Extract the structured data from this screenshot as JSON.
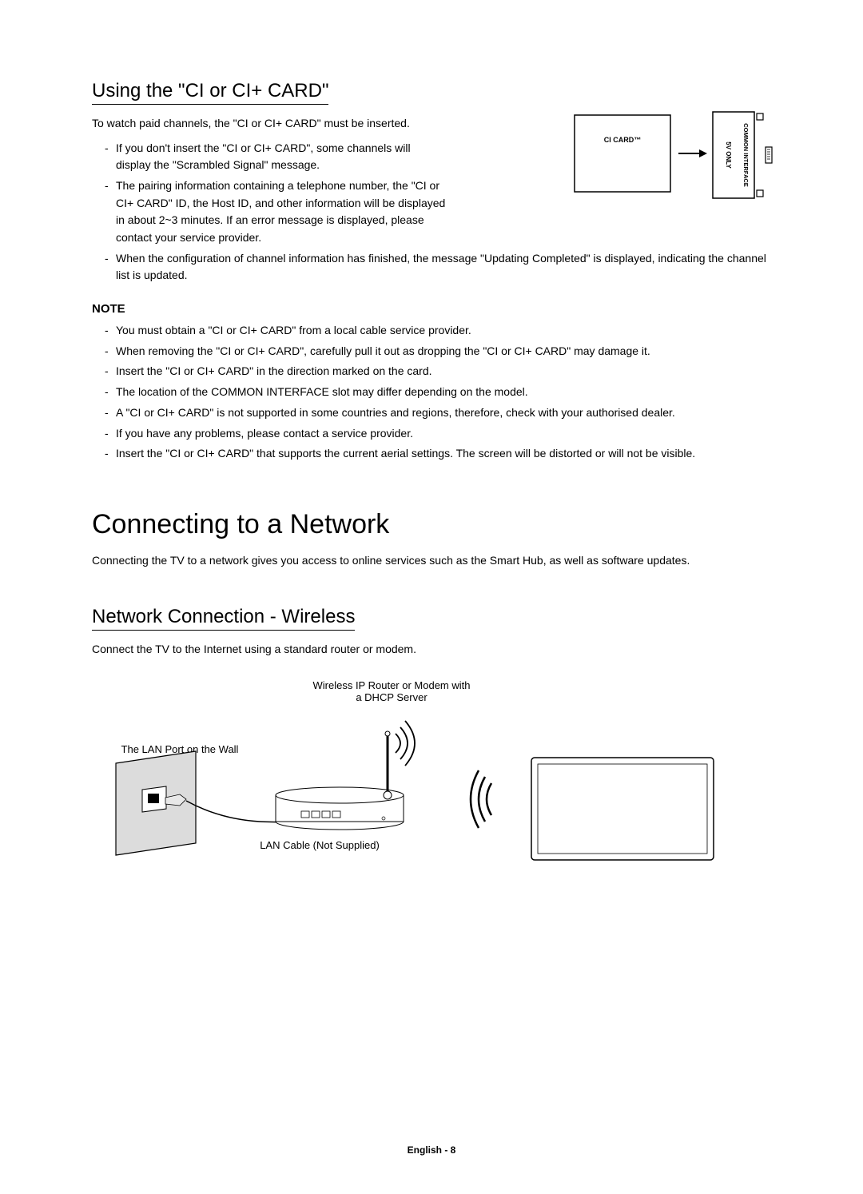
{
  "section1": {
    "title": "Using the \"CI or CI+ CARD\"",
    "intro": "To watch paid channels, the \"CI or CI+ CARD\" must be inserted.",
    "bullets": [
      "If you don't insert the \"CI or CI+ CARD\", some channels will display the \"Scrambled Signal\" message.",
      "The pairing information containing a telephone number, the \"CI or CI+ CARD\" ID, the Host ID, and other information will be displayed in about 2~3 minutes. If an error message is displayed, please contact your service provider.",
      "When the configuration of channel information has finished, the message \"Updating Completed\" is displayed, indicating the channel list is updated."
    ],
    "note_heading": "NOTE",
    "note_bullets": [
      "You must obtain a \"CI or CI+ CARD\" from a local cable service provider.",
      "When removing the \"CI or CI+ CARD\", carefully pull it out as dropping the \"CI or CI+ CARD\" may damage it.",
      "Insert the \"CI or CI+ CARD\" in the direction marked on the card.",
      "The location of the COMMON INTERFACE slot may differ depending on the model.",
      "A \"CI or CI+ CARD\" is not supported in some countries and regions, therefore, check with your authorised dealer.",
      "If you have any problems, please contact a service provider.",
      "Insert the \"CI or CI+ CARD\" that supports the current aerial settings. The screen will be distorted or will not be visible."
    ]
  },
  "section2": {
    "heading": "Connecting to a Network",
    "intro": "Connecting the TV to a network gives you access to online services such as the Smart Hub, as well as software updates.",
    "subsection_title": "Network Connection - Wireless",
    "sub_intro": "Connect the TV to the Internet using a standard router or modem."
  },
  "diagram_ci": {
    "card_label": "CI CARD™",
    "slot_label_top": "COMMON INTERFACE",
    "slot_label_bottom": "5V ONLY"
  },
  "diagram_wireless": {
    "router_label_line1": "Wireless IP Router or Modem with",
    "router_label_line2": "a DHCP Server",
    "wall_label": "The LAN Port on the Wall",
    "cable_label": "LAN Cable (Not Supplied)"
  },
  "footer": {
    "text": "English - 8"
  }
}
